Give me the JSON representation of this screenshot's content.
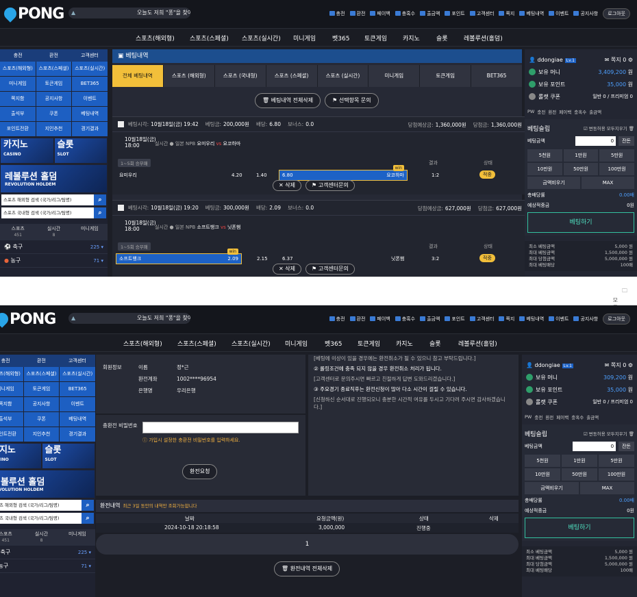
{
  "brand": {
    "logo": "PONG"
  },
  "top": {
    "marquee": "오늘도 저희 \"퐁\"을 찾아주셔",
    "links": [
      "충전",
      "환전",
      "페이백",
      "충혹수",
      "출금액",
      "포인트",
      "고객센터",
      "쪽지",
      "베팅내역",
      "이벤트",
      "공지사항"
    ],
    "logout": "로그아웃"
  },
  "nav": [
    "스포츠(해외형)",
    "스포츠(스페셜)",
    "스포츠(실시간)",
    "미니게임",
    "벳365",
    "토큰게임",
    "카지노",
    "슬롯",
    "레볼루션(홀덤)"
  ],
  "sidebar": {
    "quick": [
      "충전",
      "환전",
      "고객센터"
    ],
    "menu": [
      "스포츠(해외형)",
      "스포츠(스페셜)",
      "스포츠(실시간)",
      "미니게임",
      "토큰게임",
      "BET365",
      "쪽지함",
      "공지사항",
      "이벤트",
      "출석부",
      "쿠폰",
      "베팅내역",
      "포인트전환",
      "지인추천",
      "경기결과"
    ],
    "promo_casino": "카지노",
    "promo_casino_sub": "CASINO",
    "promo_slot": "슬롯",
    "promo_slot_sub": "SLOT",
    "promo_rev": "레볼루션 홀덤",
    "promo_rev_sub": "REVOLUTION HOLDEM",
    "search1": "스포츠 해외형 검색 (국가/리그/팀명)",
    "search2": "스포츠 국내형 검색 (국가/리그/팀명)",
    "sport_tabs": [
      {
        "label": "스포츠",
        "count": "451"
      },
      {
        "label": "실시간",
        "count": "8"
      },
      {
        "label": "미니게임",
        "count": ""
      }
    ],
    "leagues": [
      {
        "name": "축구",
        "count": "225"
      },
      {
        "name": "농구",
        "count": "71"
      }
    ]
  },
  "bets_page": {
    "title": "베팅내역",
    "filters": [
      "전체 베팅내역",
      "스포츠 (해외형)",
      "스포츠 (국내형)",
      "스포츠 (스페셜)",
      "스포츠 (실시간)",
      "미니게임",
      "토큰게임",
      "BET365"
    ],
    "delete_all": "베팅내역 전체삭제",
    "inquire": "선택항목 문의",
    "bets": [
      {
        "time_label": "베팅시각:",
        "time": "10월18일(금) 19:42",
        "amount_label": "베팅금:",
        "amount": "200,000원",
        "odds_label": "배당:",
        "odds": "6.80",
        "bonus_label": "보너스:",
        "bonus": "0.0",
        "expected_label": "당첨예상금:",
        "expected": "1,360,000원",
        "won_label": "당첨금:",
        "won": "1,360,000원",
        "date": "10월18일(금)",
        "clock": "18:00",
        "live_label": "실시간",
        "league": "일본 NPB",
        "home": "요미우리",
        "vs": "vs",
        "away": "요코하마",
        "market": "1~5회 승무패",
        "result_h": "결과",
        "status_h": "상태",
        "sel_home": "요미우리",
        "draw": "4.20",
        "draw2": "1.40",
        "pick_odds": "6.80",
        "pick": "요코하마",
        "win": "win",
        "score": "1:2",
        "status": "적중",
        "btn_delete": "삭제",
        "btn_inquiry": "고객센터문의"
      },
      {
        "time_label": "베팅시각:",
        "time": "10월18일(금) 19:20",
        "amount_label": "베팅금:",
        "amount": "300,000원",
        "odds_label": "배당:",
        "odds": "2.09",
        "bonus_label": "보너스:",
        "bonus": "0.0",
        "expected_label": "당첨예상금:",
        "expected": "627,000원",
        "won_label": "당첨금:",
        "won": "627,000원",
        "date": "10월18일(금)",
        "clock": "18:00",
        "live_label": "실시간",
        "league": "일본 NPB",
        "home": "소프트뱅크",
        "vs": "vs",
        "away": "닛폰햄",
        "market": "1~5회 승무패",
        "result_h": "결과",
        "status_h": "상태",
        "pick": "소프트뱅크",
        "pick_odds": "2.09",
        "draw": "2.15",
        "draw2": "6.37",
        "sel_away": "닛폰햄",
        "win": "win",
        "score": "3:2",
        "status": "적중",
        "btn_delete": "삭제",
        "btn_inquiry": "고객센터문의"
      }
    ]
  },
  "bookmarks": "모든 북마크",
  "withdraw_page": {
    "info_label": "회원정보",
    "name_k": "이름",
    "name_v": "정*근",
    "acct_k": "환전계좌",
    "acct_v": "1002****96954",
    "bank_k": "은행명",
    "bank_v": "우리은행",
    "pw_label": "충환전 비밀번호",
    "pw_hint": "가입시 설정한 충환전 비밀번호를 입력하세요.",
    "submit": "환전요청",
    "note0": "[베팅에 이상이 있을 경우에는 환전취소가 될 수 있으니 참고 부탁드립니다.]",
    "note1": "② 롤링조건에 충족 되지 않을 경우 환전취소 처리가 됩니다.",
    "note1b": "[고객센터로 문의주시면 빠르고 친절하게 답변 도와드리겠습니다.]",
    "note2": "③ 주요경기 종료직후는 환전신청이 많아 다소 시간이 걸릴 수 있습니다.",
    "note2b": "[신청하신 순서대로 진행되오니 충분한 시간적 여유를 두시고 기다려 주시면 감사하겠습니다.]",
    "history_title": "환전내역",
    "history_sub": "최근 3일 동안의 내역만 조회가능합니다",
    "cols": [
      "날짜",
      "요청금액(원)",
      "상태",
      "삭제"
    ],
    "row": {
      "date": "2024-10-18 20:18:58",
      "amount": "3,000,000",
      "status": "진행중"
    },
    "page": "1",
    "delete_all": "환전내역 전체삭제"
  },
  "user": {
    "name": "ddongiae",
    "level": "Lv.1",
    "msg_label": "쪽지",
    "msg": "0",
    "money_label": "보유 머니",
    "point_label": "보유 포인트",
    "point": "35,000",
    "unit": "원",
    "coupon_label": "롤랫 쿠폰",
    "coupon": "일반 0 / 프리미엄 0",
    "links": [
      "PW",
      "충전",
      "환전",
      "페이백",
      "충혹수",
      "출금액"
    ]
  },
  "user_states": [
    {
      "money": "3,409,200"
    },
    {
      "money": "309,200"
    }
  ],
  "slip": {
    "title": "베팅슬립",
    "toggle": "변동허용",
    "clear": "모두지우기",
    "amount_label": "베팅금액",
    "amount": "0",
    "reset": "잔돈",
    "chips": [
      "5천원",
      "1만원",
      "5만원",
      "10만원",
      "50만원",
      "100만원"
    ],
    "half": "금액비우기",
    "max": "MAX",
    "odds_label": "총배당률",
    "odds": "0.00배",
    "win_label": "예상적중금",
    "win": "0원",
    "place": "베팅하기",
    "limits": [
      {
        "k": "최소 베팅금액",
        "v": "5,000 원"
      },
      {
        "k": "최대 베팅금액",
        "v": "1,500,000 원"
      },
      {
        "k": "최대 당첨금액",
        "v": "5,000,000 원"
      },
      {
        "k": "최대 베팅배당",
        "v": "100배"
      }
    ]
  },
  "colors": {
    "accent": "#1d62c6",
    "gold": "#f2bf3a",
    "bg": "#1c1e26"
  }
}
